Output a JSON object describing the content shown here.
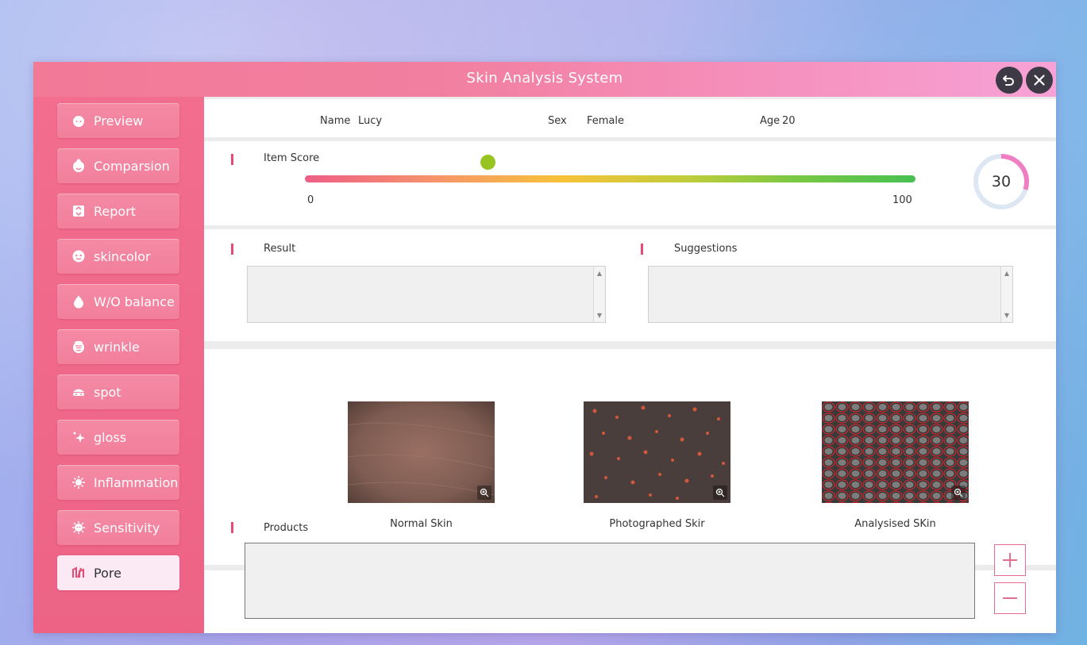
{
  "app": {
    "title": "Skin Analysis System"
  },
  "sidebar": {
    "items": [
      {
        "label": "Preview",
        "icon": "face-icon"
      },
      {
        "label": "Comparsion",
        "icon": "face-compare-icon"
      },
      {
        "label": "Report",
        "icon": "report-icon"
      },
      {
        "label": "skincolor",
        "icon": "skincolor-icon"
      },
      {
        "label": "W/O balance",
        "icon": "droplet-icon"
      },
      {
        "label": "wrinkle",
        "icon": "wrinkle-icon"
      },
      {
        "label": "spot",
        "icon": "spot-icon"
      },
      {
        "label": "gloss",
        "icon": "sparkle-icon"
      },
      {
        "label": "Inflammation",
        "icon": "inflammation-icon"
      },
      {
        "label": "Sensitivity",
        "icon": "sensitivity-icon"
      },
      {
        "label": "Pore",
        "icon": "pore-icon",
        "active": true
      }
    ]
  },
  "patient": {
    "name_label": "Name",
    "name": "Lucy",
    "sex_label": "Sex",
    "sex": "Female",
    "age_label": "Age",
    "age": "20"
  },
  "score": {
    "label": "Item Score",
    "min_label": "0",
    "max_label": "100",
    "value": 30,
    "value_text": "30"
  },
  "result": {
    "label": "Result",
    "text": ""
  },
  "suggestions": {
    "label": "Suggestions",
    "text": ""
  },
  "images": [
    {
      "caption": "Normal Skin"
    },
    {
      "caption": "Photographed Skir"
    },
    {
      "caption": "Analysised SKin"
    }
  ],
  "products": {
    "label": "Products",
    "text": ""
  },
  "colors": {
    "accent": "#ee6d8e",
    "marker": "#e94a74",
    "score_dot": "#98c421"
  }
}
